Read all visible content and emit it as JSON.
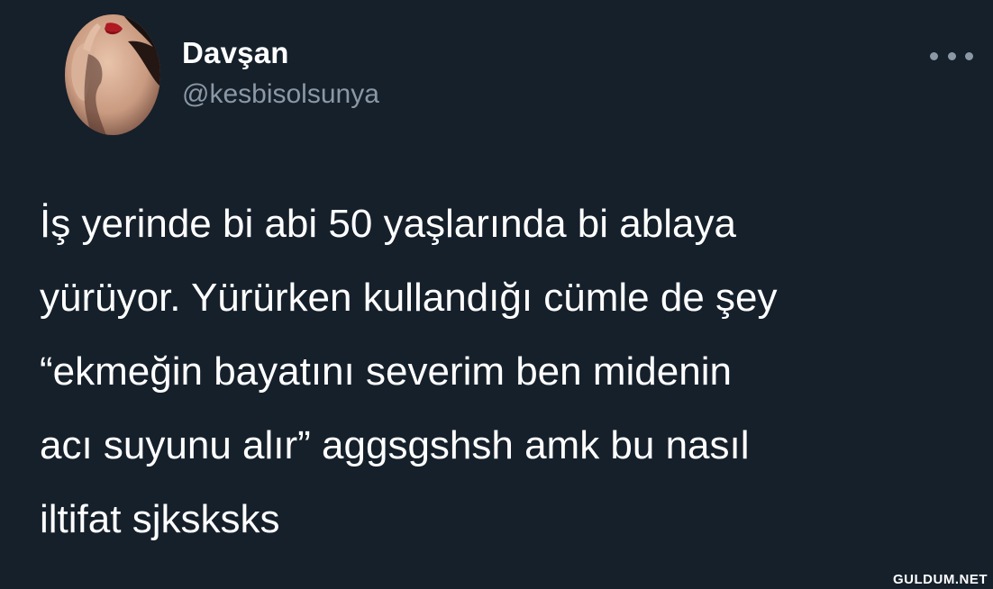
{
  "tweet": {
    "author": {
      "display_name": "Davşan",
      "handle": "@kesbisolsunya"
    },
    "text_lines": [
      "İş yerinde bi abi 50 yaşlarında bi ablaya",
      "yürüyor. Yürürken kullandığı cümle de şey",
      "“ekmeğin bayatını severim ben midenin",
      "acı suyunu alır” aggsgshsh amk bu nasıl",
      "iltifat sjksksks"
    ]
  },
  "icons": {
    "more": "more-horizontal-icon"
  },
  "watermark": "GULDUM.NET",
  "colors": {
    "background": "#15202b",
    "primary_text": "#ffffff",
    "secondary_text": "#8b98a5"
  }
}
